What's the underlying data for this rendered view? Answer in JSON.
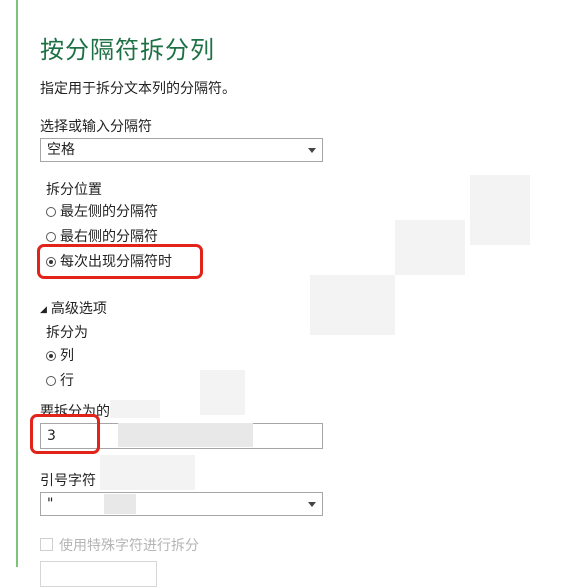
{
  "dialog": {
    "title": "按分隔符拆分列",
    "subtitle": "指定用于拆分文本列的分隔符。"
  },
  "delimiter": {
    "label": "选择或输入分隔符",
    "selected": "空格"
  },
  "split_position": {
    "label": "拆分位置",
    "options": [
      {
        "label": "最左侧的分隔符",
        "checked": false
      },
      {
        "label": "最右侧的分隔符",
        "checked": false
      },
      {
        "label": "每次出现分隔符时",
        "checked": true
      }
    ]
  },
  "advanced": {
    "toggle_label": "高级选项",
    "split_into_label": "拆分为",
    "split_into_options": [
      {
        "label": "列",
        "checked": true
      },
      {
        "label": "行",
        "checked": false
      }
    ],
    "column_count_label": "要拆分为的列数",
    "column_count_value": "3",
    "quote_char_label": "引号字符",
    "quote_char_value": "\"",
    "special_chars_label": "使用特殊字符进行拆分"
  },
  "colors": {
    "title": "#1e7145",
    "highlight": "#e2231a",
    "accent_rule": "#7cc47a"
  }
}
